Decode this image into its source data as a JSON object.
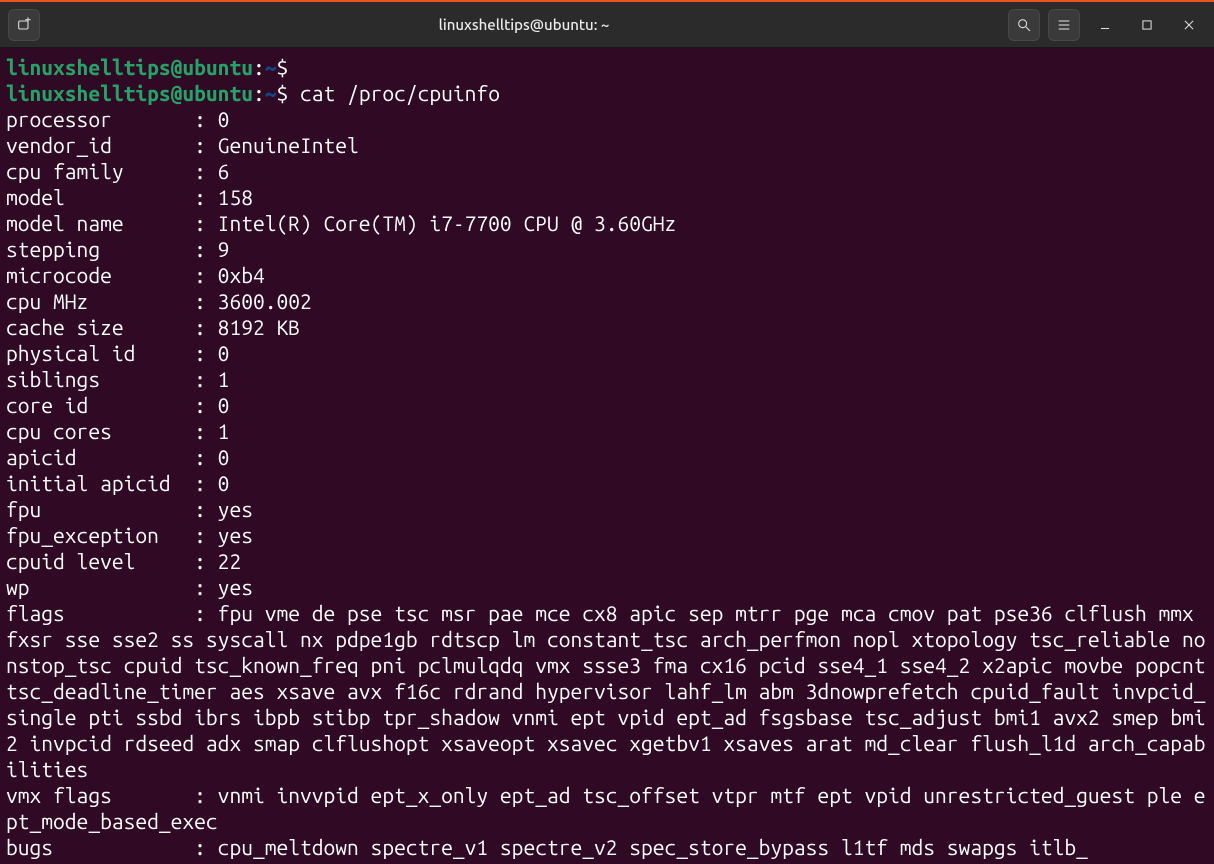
{
  "window": {
    "title": "linuxshelltips@ubuntu: ~"
  },
  "prompt": {
    "userhost": "linuxshelltips@ubuntu",
    "sep1": ":",
    "path": "~",
    "sigil": "$",
    "command": "cat /proc/cpuinfo"
  },
  "cpuinfo": [
    {
      "k": "processor",
      "v": "0"
    },
    {
      "k": "vendor_id",
      "v": "GenuineIntel"
    },
    {
      "k": "cpu family",
      "v": "6"
    },
    {
      "k": "model",
      "v": "158"
    },
    {
      "k": "model name",
      "v": "Intel(R) Core(TM) i7-7700 CPU @ 3.60GHz"
    },
    {
      "k": "stepping",
      "v": "9"
    },
    {
      "k": "microcode",
      "v": "0xb4"
    },
    {
      "k": "cpu MHz",
      "v": "3600.002"
    },
    {
      "k": "cache size",
      "v": "8192 KB"
    },
    {
      "k": "physical id",
      "v": "0"
    },
    {
      "k": "siblings",
      "v": "1"
    },
    {
      "k": "core id",
      "v": "0"
    },
    {
      "k": "cpu cores",
      "v": "1"
    },
    {
      "k": "apicid",
      "v": "0"
    },
    {
      "k": "initial apicid",
      "v": "0"
    },
    {
      "k": "fpu",
      "v": "yes"
    },
    {
      "k": "fpu_exception",
      "v": "yes"
    },
    {
      "k": "cpuid level",
      "v": "22"
    },
    {
      "k": "wp",
      "v": "yes"
    }
  ],
  "long": [
    {
      "k": "flags",
      "v": "fpu vme de pse tsc msr pae mce cx8 apic sep mtrr pge mca cmov pat pse36 clflush mmx fxsr sse sse2 ss syscall nx pdpe1gb rdtscp lm constant_tsc arch_perfmon nopl xtopology tsc_reliable nonstop_tsc cpuid tsc_known_freq pni pclmulqdq vmx ssse3 fma cx16 pcid sse4_1 sse4_2 x2apic movbe popcnt tsc_deadline_timer aes xsave avx f16c rdrand hypervisor lahf_lm abm 3dnowprefetch cpuid_fault invpcid_single pti ssbd ibrs ibpb stibp tpr_shadow vnmi ept vpid ept_ad fsgsbase tsc_adjust bmi1 avx2 smep bmi2 invpcid rdseed adx smap clflushopt xsaveopt xsavec xgetbv1 xsaves arat md_clear flush_l1d arch_capabilities"
    },
    {
      "k": "vmx flags",
      "v": "vnmi invvpid ept_x_only ept_ad tsc_offset vtpr mtf ept vpid unrestricted_guest ple ept_mode_based_exec"
    },
    {
      "k": "bugs",
      "v": "cpu_meltdown spectre_v1 spectre_v2 spec_store_bypass l1tf mds swapgs itlb_"
    }
  ],
  "keycol": 16
}
